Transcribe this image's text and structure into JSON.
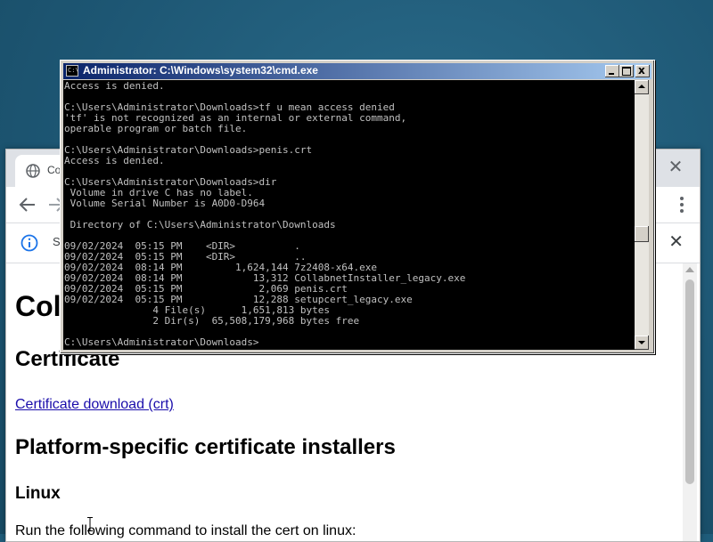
{
  "browser": {
    "tab_title": "Col",
    "close_glyph": "✕",
    "infobar": {
      "text": "S",
      "close_glyph": "✕"
    },
    "content": {
      "heading": "Col",
      "certificate_heading": "Certificate",
      "certificate_link": "Certificate download (crt)",
      "platform_heading": "Platform-specific certificate installers",
      "linux_heading": "Linux",
      "linux_text": "Run the following command to install the cert on linux:"
    }
  },
  "cmd": {
    "title": "Administrator: C:\\Windows\\system32\\cmd.exe",
    "icon_text": "C:\\",
    "close_glyph": "x",
    "lines": [
      "Access is denied.",
      "",
      "C:\\Users\\Administrator\\Downloads>tf u mean access denied",
      "'tf' is not recognized as an internal or external command,",
      "operable program or batch file.",
      "",
      "C:\\Users\\Administrator\\Downloads>penis.crt",
      "Access is denied.",
      "",
      "C:\\Users\\Administrator\\Downloads>dir",
      " Volume in drive C has no label.",
      " Volume Serial Number is A0D0-D964",
      "",
      " Directory of C:\\Users\\Administrator\\Downloads",
      "",
      "09/02/2024  05:15 PM    <DIR>          .",
      "09/02/2024  05:15 PM    <DIR>          ..",
      "09/02/2024  08:14 PM         1,624,144 7z2408-x64.exe",
      "09/02/2024  08:14 PM            13,312 CollabnetInstaller_legacy.exe",
      "09/02/2024  05:15 PM             2,069 penis.crt",
      "09/02/2024  05:15 PM            12,288 setupcert_legacy.exe",
      "               4 File(s)      1,651,813 bytes",
      "               2 Dir(s)  65,508,179,968 bytes free",
      "",
      "C:\\Users\\Administrator\\Downloads>"
    ]
  },
  "colors": {
    "desktop": "#1f5c7a",
    "console_bg": "#000000",
    "console_fg": "#c0c0c0",
    "titlebar_start": "#0a246a",
    "titlebar_end": "#a6caf0",
    "link": "#1a0dab"
  },
  "icons": {
    "tab_favicon": "globe-icon",
    "back": "arrow-left-icon",
    "forward": "arrow-right-icon",
    "menu": "more-vertical-icon",
    "info": "info-icon"
  }
}
